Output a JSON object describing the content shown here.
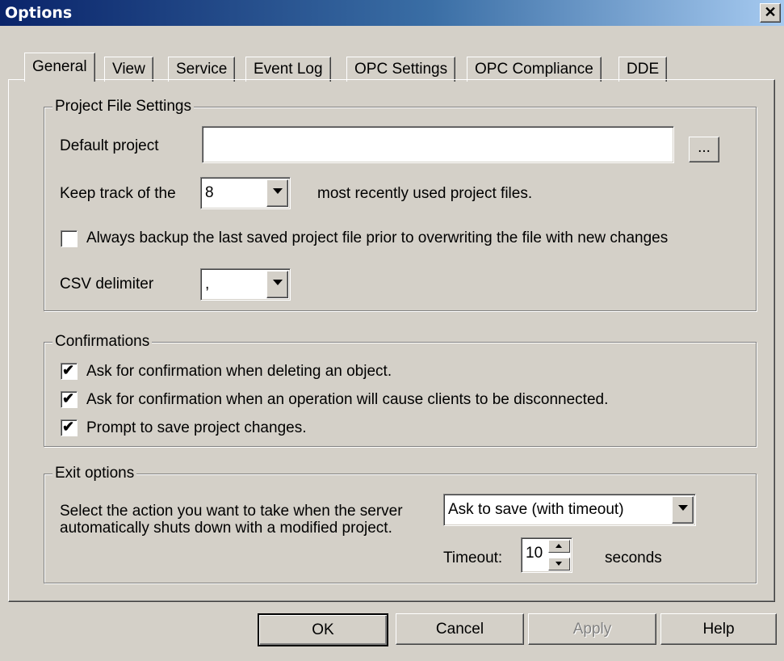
{
  "window": {
    "title": "Options",
    "close_glyph": "✕"
  },
  "tabs": [
    {
      "label": "General",
      "active": true
    },
    {
      "label": "View"
    },
    {
      "label": "Service"
    },
    {
      "label": "Event Log"
    },
    {
      "label": "OPC Settings"
    },
    {
      "label": "OPC Compliance"
    },
    {
      "label": "DDE"
    }
  ],
  "project_file_settings": {
    "legend": "Project File Settings",
    "default_project_label": "Default project",
    "default_project_value": "",
    "browse_label": "...",
    "keep_track_prefix": "Keep track of the",
    "keep_track_value": "8",
    "keep_track_suffix": "most recently used project files.",
    "backup_label": "Always backup the last saved project file prior to overwriting the file with new changes",
    "backup_checked": false,
    "csv_label": "CSV delimiter",
    "csv_value": ","
  },
  "confirmations": {
    "legend": "Confirmations",
    "items": [
      {
        "label": "Ask for confirmation when deleting an object.",
        "checked": true
      },
      {
        "label": "Ask for confirmation when an operation will cause clients to be disconnected.",
        "checked": true
      },
      {
        "label": "Prompt to save project changes.",
        "checked": true
      }
    ]
  },
  "exit_options": {
    "legend": "Exit options",
    "description": "Select the action you want to take when the server automatically shuts down with a modified project.",
    "action_value": "Ask to save (with timeout)",
    "timeout_label": "Timeout:",
    "timeout_value": "10",
    "timeout_unit": "seconds"
  },
  "buttons": {
    "ok": "OK",
    "cancel": "Cancel",
    "apply": "Apply",
    "help": "Help"
  },
  "colors": {
    "titlebar_start": "#0a246a",
    "titlebar_end": "#a6caf0",
    "face": "#d4d0c8"
  }
}
